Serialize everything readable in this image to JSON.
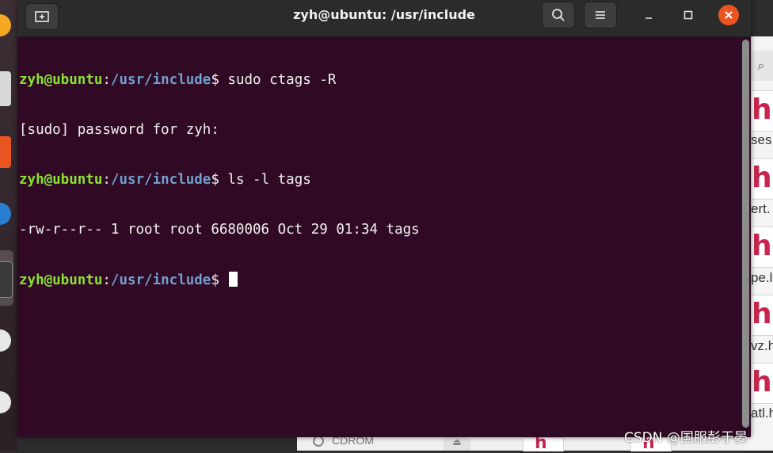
{
  "window": {
    "title": "zyh@ubuntu: /usr/include"
  },
  "terminal": {
    "lines": [
      {
        "user": "zyh@ubuntu",
        "sep": ":",
        "path": "/usr/include",
        "prompt": "$ ",
        "command": "sudo ctags -R"
      },
      {
        "output": "[sudo] password for zyh:"
      },
      {
        "user": "zyh@ubuntu",
        "sep": ":",
        "path": "/usr/include",
        "prompt": "$ ",
        "command": "ls -l tags"
      },
      {
        "output": "-rw-r--r-- 1 root root 6680006 Oct 29 01:34 tags"
      },
      {
        "user": "zyh@ubuntu",
        "sep": ":",
        "path": "/usr/include",
        "prompt": "$ ",
        "command": ""
      }
    ],
    "colors": {
      "background": "#300a24",
      "user": "#8ae234",
      "path": "#729fcf",
      "text": "#f2f2f2"
    }
  },
  "background_window": {
    "file_labels": [
      "ses",
      "ert.",
      "pe.l",
      "vz.h",
      "atl.h"
    ],
    "device_label": "CDROM"
  },
  "watermark": "CSDN @国服彭于晏",
  "colors": {
    "close_button": "#e95420",
    "file_icon": "#c7254e"
  }
}
